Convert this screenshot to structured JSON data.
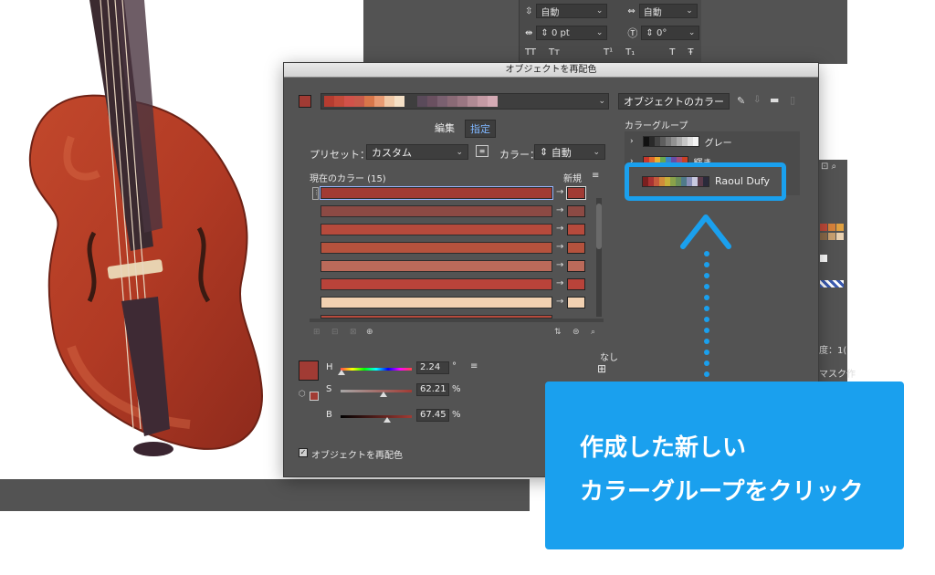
{
  "type_panel": {
    "leading_label": "自動",
    "tracking_label": "自動",
    "kerning_value": "0 pt",
    "rotation_value": "0°",
    "buttons": [
      "TT",
      "Tт",
      "T¹",
      "T₁",
      "T",
      "Ŧ"
    ]
  },
  "dialog": {
    "title": "オブジェクトを再配色",
    "color_group_name": "オブジェクトのカラー",
    "tabs": [
      "編集",
      "指定"
    ],
    "active_tab": "指定",
    "preset_label": "プリセット：",
    "preset_value": "カスタム",
    "colors_label": "カラー：",
    "colors_value": "自動",
    "current_colors_label": "現在のカラー (15)",
    "new_label": "新規",
    "color_groups_title": "カラーグループ",
    "color_groups": [
      {
        "name": "グレー",
        "colors": [
          "#111111",
          "#2a2a2a",
          "#444444",
          "#5e5e5e",
          "#787878",
          "#929292",
          "#acacac",
          "#c6c6c6",
          "#e0e0e0",
          "#f4f4f4"
        ]
      },
      {
        "name": "輝き",
        "colors": [
          "#c9372c",
          "#e06a2c",
          "#e9b030",
          "#6aa84f",
          "#3d85c6",
          "#674ea7",
          "#a64d79",
          "#cc4125"
        ]
      },
      {
        "name": "Raoul Dufy",
        "colors": [
          "#7a1f1f",
          "#a83232",
          "#c45a3c",
          "#d18b3a",
          "#c6b03a",
          "#8aa24a",
          "#6a8f5a",
          "#4f7a8a",
          "#8a8fb8",
          "#c9c9e0",
          "#5a3a4a",
          "#2a2a3a"
        ]
      }
    ],
    "current_rows": [
      {
        "current": "#a13b34",
        "new": "#a13b34",
        "selected": true
      },
      {
        "current": "#8c4a44",
        "new": "#8c4a44"
      },
      {
        "current": "#b64a3c",
        "new": "#b64a3c"
      },
      {
        "current": "#b5523d",
        "new": "#b5523d"
      },
      {
        "current": "#bb6a5a",
        "new": "#bb6a5a"
      },
      {
        "current": "#b9433a",
        "new": "#b9433a"
      },
      {
        "current": "#f2d1b1",
        "new": "#f2d1b1"
      }
    ],
    "h_label": "H",
    "s_label": "S",
    "b_label": "B",
    "h_value": "2.24",
    "h_unit": "°",
    "s_value": "62.21",
    "s_unit": "%",
    "b_value": "67.45",
    "b_unit": "%",
    "none_label": "なし",
    "recolor_checkbox_label": "オブジェクトを再配色",
    "recolor_checked": true,
    "current_swatch_color": "#a13b34",
    "top_swatches": [
      "#b63c30",
      "#c44a3a",
      "#d0524a",
      "#c85a4a",
      "#d8764a",
      "#e89a72",
      "#f0c8a6",
      "#f5e0c6",
      "#5a4a5a",
      "#6a5060",
      "#7a6070",
      "#8a6a76",
      "#9a7682",
      "#b08a94",
      "#c49aa4",
      "#d4aab4"
    ]
  },
  "callout": {
    "line1": "作成した新しい",
    "line2": "カラーグループをクリック"
  },
  "right_strip": {
    "label_a": "度：1(",
    "label_b": "マスク作"
  },
  "colors": {
    "accent": "#1aa0ee",
    "dialog_bg": "#535353",
    "panel_dark": "#3e3e3e"
  }
}
